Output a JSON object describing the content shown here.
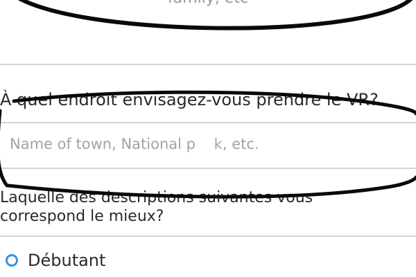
{
  "previous_field": {
    "placeholder_tail": "family, etc"
  },
  "location_question": {
    "label": "À quel endroit envisagez-vous prendre le VR?",
    "input_placeholder": "Name of town, National p    k, etc.",
    "input_value": ""
  },
  "experience_question": {
    "label_line1": "Laquelle des descriptions suivantes vous",
    "label_line2": "correspond le mieux?",
    "options": [
      {
        "label": "Débutant",
        "selected": false
      }
    ]
  },
  "annotation": {
    "color": "#0a0a0a"
  }
}
